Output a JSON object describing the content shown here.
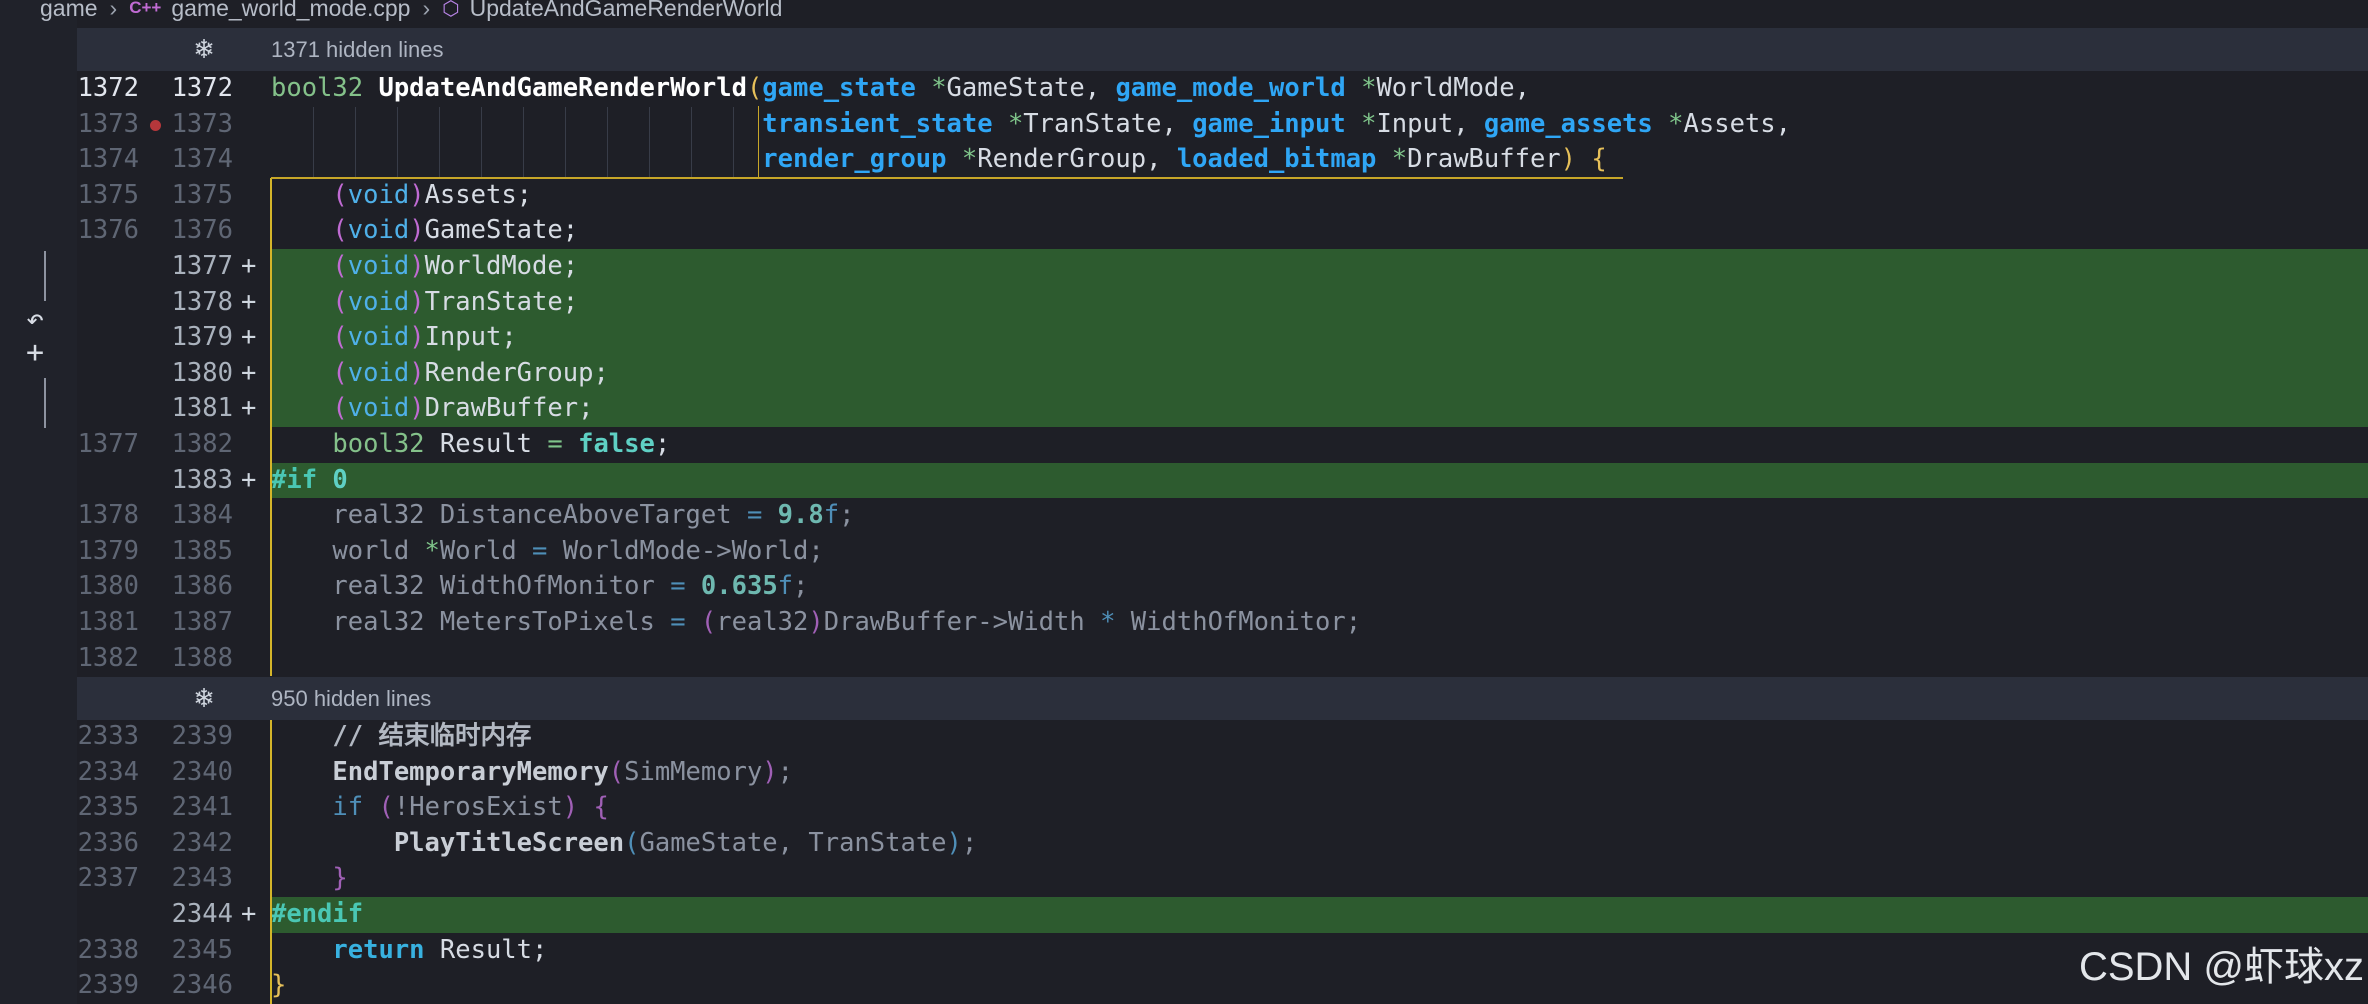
{
  "breadcrumb": {
    "folder": "game",
    "file_icon": "C++",
    "file": "game_world_mode.cpp",
    "symbol_icon": "symbol-icon",
    "symbol": "UpdateAndGameRenderWorld"
  },
  "folds": [
    {
      "text": "1371 hidden lines",
      "icon": "expand-icon"
    },
    {
      "text": "950 hidden lines",
      "icon": "expand-icon"
    }
  ],
  "gutter_controls": {
    "revert_icon": "↶",
    "add_icon": "+"
  },
  "rows": [
    {
      "o": "1372",
      "n": "1372",
      "cur": true,
      "segs": [
        [
          "t-type",
          "bool32 "
        ],
        [
          "t-fn",
          "UpdateAndGameRenderWorld"
        ],
        [
          "t-paren",
          "("
        ],
        [
          "t-tdef",
          "game_state"
        ],
        [
          "t-var",
          " "
        ],
        [
          "t-star",
          "*"
        ],
        [
          "t-var",
          "GameState, "
        ],
        [
          "t-tdef",
          "game_mode_world"
        ],
        [
          "t-var",
          " "
        ],
        [
          "t-star",
          "*"
        ],
        [
          "t-var",
          "WorldMode,"
        ]
      ]
    },
    {
      "o": "1373",
      "n": "1373",
      "bp": true,
      "indent": "                                ",
      "segs": [
        [
          "t-tdef",
          "transient_state"
        ],
        [
          "t-var",
          " "
        ],
        [
          "t-star",
          "*"
        ],
        [
          "t-var",
          "TranState, "
        ],
        [
          "t-tdef",
          "game_input"
        ],
        [
          "t-var",
          " "
        ],
        [
          "t-star",
          "*"
        ],
        [
          "t-var",
          "Input, "
        ],
        [
          "t-tdef",
          "game_assets"
        ],
        [
          "t-var",
          " "
        ],
        [
          "t-star",
          "*"
        ],
        [
          "t-var",
          "Assets,"
        ]
      ]
    },
    {
      "o": "1374",
      "n": "1374",
      "indent": "                                ",
      "segs": [
        [
          "t-tdef",
          "render_group"
        ],
        [
          "t-var",
          " "
        ],
        [
          "t-star",
          "*"
        ],
        [
          "t-var",
          "RenderGroup, "
        ],
        [
          "t-tdef",
          "loaded_bitmap"
        ],
        [
          "t-var",
          " "
        ],
        [
          "t-star",
          "*"
        ],
        [
          "t-var",
          "DrawBuffer"
        ],
        [
          "t-paren",
          ")"
        ],
        [
          "t-var",
          " "
        ],
        [
          "t-paren",
          "{"
        ]
      ]
    },
    {
      "o": "1375",
      "n": "1375",
      "bar": true,
      "indent": "    ",
      "segs": [
        [
          "t-void",
          "("
        ],
        [
          "t-voidkw",
          "void"
        ],
        [
          "t-void",
          ")"
        ],
        [
          "t-var",
          "Assets;"
        ]
      ]
    },
    {
      "o": "1376",
      "n": "1376",
      "bar": true,
      "indent": "    ",
      "segs": [
        [
          "t-void",
          "("
        ],
        [
          "t-voidkw",
          "void"
        ],
        [
          "t-void",
          ")"
        ],
        [
          "t-var",
          "GameState;"
        ]
      ]
    },
    {
      "o": "",
      "n": "1377",
      "cur": true,
      "added": true,
      "bar": true,
      "indent": "    ",
      "segs": [
        [
          "t-void",
          "("
        ],
        [
          "t-voidkw",
          "void"
        ],
        [
          "t-void",
          ")"
        ],
        [
          "t-var",
          "WorldMode;"
        ]
      ]
    },
    {
      "o": "",
      "n": "1378",
      "added": true,
      "bar": true,
      "indent": "    ",
      "segs": [
        [
          "t-void",
          "("
        ],
        [
          "t-voidkw",
          "void"
        ],
        [
          "t-void",
          ")"
        ],
        [
          "t-var",
          "TranState;"
        ]
      ]
    },
    {
      "o": "",
      "n": "1379",
      "added": true,
      "bar": true,
      "indent": "    ",
      "segs": [
        [
          "t-void",
          "("
        ],
        [
          "t-voidkw",
          "void"
        ],
        [
          "t-void",
          ")"
        ],
        [
          "t-var",
          "Input;"
        ]
      ]
    },
    {
      "o": "",
      "n": "1380",
      "added": true,
      "bar": true,
      "indent": "    ",
      "segs": [
        [
          "t-void",
          "("
        ],
        [
          "t-voidkw",
          "void"
        ],
        [
          "t-void",
          ")"
        ],
        [
          "t-var",
          "RenderGroup;"
        ]
      ]
    },
    {
      "o": "",
      "n": "1381",
      "added": true,
      "bar": true,
      "indent": "    ",
      "segs": [
        [
          "t-void",
          "("
        ],
        [
          "t-voidkw",
          "void"
        ],
        [
          "t-void",
          ")"
        ],
        [
          "t-var",
          "DrawBuffer;"
        ]
      ]
    },
    {
      "o": "1377",
      "n": "1382",
      "bar": true,
      "indent": "    ",
      "segs": [
        [
          "t-type",
          "bool32"
        ],
        [
          "t-var",
          " Result "
        ],
        [
          "t-star",
          "="
        ],
        [
          "t-var",
          " "
        ],
        [
          "t-num",
          "false"
        ],
        [
          "t-var",
          ";"
        ]
      ]
    },
    {
      "o": "",
      "n": "1383",
      "added": true,
      "bar": true,
      "indent": "",
      "segs": [
        [
          "t-pre",
          "#if "
        ],
        [
          "t-num",
          "0"
        ]
      ]
    },
    {
      "o": "1378",
      "n": "1384",
      "bar": true,
      "indent": "    ",
      "segs": [
        [
          "t-dim",
          "real32 DistanceAboveTarget "
        ],
        [
          "t-dimkw",
          "="
        ],
        [
          "t-dim",
          " "
        ],
        [
          "t-dimnum",
          "9.8"
        ],
        [
          "t-dimkw",
          "f"
        ],
        [
          "t-dim",
          ";"
        ]
      ]
    },
    {
      "o": "1379",
      "n": "1385",
      "bar": true,
      "indent": "    ",
      "segs": [
        [
          "t-dim",
          "world "
        ],
        [
          "t-star",
          "*"
        ],
        [
          "t-dim",
          "World "
        ],
        [
          "t-dimkw",
          "="
        ],
        [
          "t-dim",
          " WorldMode->World;"
        ]
      ]
    },
    {
      "o": "1380",
      "n": "1386",
      "bar": true,
      "indent": "    ",
      "segs": [
        [
          "t-dim",
          "real32 WidthOfMonitor "
        ],
        [
          "t-dimkw",
          "="
        ],
        [
          "t-dim",
          " "
        ],
        [
          "t-dimnum",
          "0.635"
        ],
        [
          "t-dimkw",
          "f"
        ],
        [
          "t-dim",
          ";"
        ]
      ]
    },
    {
      "o": "1381",
      "n": "1387",
      "bar": true,
      "indent": "    ",
      "segs": [
        [
          "t-dim",
          "real32 MetersToPixels "
        ],
        [
          "t-dimkw",
          "="
        ],
        [
          "t-dim",
          " "
        ],
        [
          "t-dimpar",
          "("
        ],
        [
          "t-dim",
          "real32"
        ],
        [
          "t-dimpar",
          ")"
        ],
        [
          "t-dim",
          "DrawBuffer->Width "
        ],
        [
          "t-dimkw",
          "*"
        ],
        [
          "t-dim",
          " WidthOfMonitor;"
        ]
      ]
    },
    {
      "o": "1382",
      "n": "1388",
      "bar": true,
      "indent": "",
      "segs": []
    },
    {
      "fold": 1
    },
    {
      "o": "2333",
      "n": "2339",
      "bar": true,
      "indent": "    ",
      "segs": [
        [
          "t-com",
          "// 结束临时内存"
        ]
      ]
    },
    {
      "o": "2334",
      "n": "2340",
      "bar": true,
      "indent": "    ",
      "segs": [
        [
          "t-fnb",
          "EndTemporaryMemory"
        ],
        [
          "t-dimpar",
          "("
        ],
        [
          "t-dim",
          "SimMemory"
        ],
        [
          "t-dimpar",
          ")"
        ],
        [
          "t-dim",
          ";"
        ]
      ]
    },
    {
      "o": "2335",
      "n": "2341",
      "bar": true,
      "indent": "    ",
      "segs": [
        [
          "t-dimkw",
          "if"
        ],
        [
          "t-dim",
          " "
        ],
        [
          "t-dimpar",
          "("
        ],
        [
          "t-dim",
          "!HerosExist"
        ],
        [
          "t-dimpar",
          ")"
        ],
        [
          "t-dim",
          " "
        ],
        [
          "t-dimpar",
          "{"
        ]
      ]
    },
    {
      "o": "2336",
      "n": "2342",
      "bar": true,
      "indent": "        ",
      "segs": [
        [
          "t-fnb",
          "PlayTitleScreen"
        ],
        [
          "t-dimkw",
          "("
        ],
        [
          "t-dim",
          "GameState, TranState"
        ],
        [
          "t-dimkw",
          ")"
        ],
        [
          "t-dim",
          ";"
        ]
      ]
    },
    {
      "o": "2337",
      "n": "2343",
      "bar": true,
      "indent": "    ",
      "segs": [
        [
          "t-dimpar",
          "}"
        ]
      ]
    },
    {
      "o": "",
      "n": "2344",
      "added": true,
      "bar": true,
      "indent": "",
      "segs": [
        [
          "t-pre",
          "#endif"
        ]
      ]
    },
    {
      "o": "2338",
      "n": "2345",
      "bar": true,
      "indent": "    ",
      "segs": [
        [
          "t-ret",
          "return"
        ],
        [
          "t-var",
          " Result;"
        ]
      ]
    },
    {
      "o": "2339",
      "n": "2346",
      "bar": true,
      "indent": "",
      "segs": [
        [
          "t-paren",
          "}"
        ]
      ]
    }
  ],
  "watermark": "CSDN @虾球xz",
  "colors": {
    "background": "#1e1f26",
    "added_line": "#2d5b2f",
    "change_bar": "#d4b52a",
    "type_keyword": "#2fa6f5"
  }
}
